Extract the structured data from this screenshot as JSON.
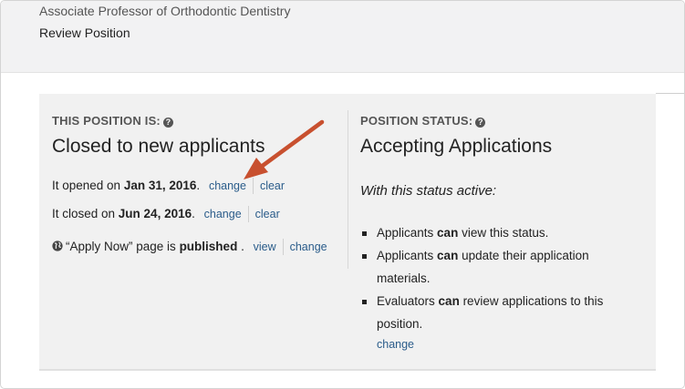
{
  "header": {
    "title": "Associate Professor of Orthodontic Dentistry",
    "subtitle": "Review Position"
  },
  "left": {
    "label": "THIS POSITION IS:",
    "state": "Closed to new applicants",
    "opened_prefix": "It opened on ",
    "opened_date": "Jan 31, 2016",
    "closed_prefix": "It closed on ",
    "closed_date": "Jun 24, 2016",
    "period": ".",
    "apply_prefix": "“Apply Now” page is ",
    "apply_state": "published",
    "apply_suffix": " .",
    "change_label": "change",
    "clear_label": "clear",
    "view_label": "view"
  },
  "right": {
    "label": "POSITION STATUS:",
    "state": "Accepting Applications",
    "intro": "With this status active:",
    "items": [
      {
        "pre": "Applicants ",
        "bold": "can",
        "post": " view this status."
      },
      {
        "pre": "Applicants ",
        "bold": "can",
        "post": " update their application materials."
      },
      {
        "pre": "Evaluators ",
        "bold": "can",
        "post": " review applications to this position."
      }
    ],
    "change_label": "change"
  },
  "colors": {
    "link": "#2a5c8a",
    "arrow": "#c8502f",
    "panel": "#f1f1f1",
    "header": "#f2f2f3"
  }
}
